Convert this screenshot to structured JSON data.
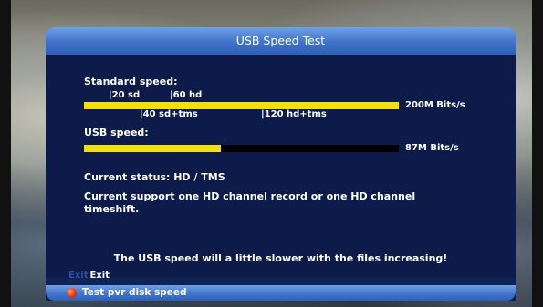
{
  "window": {
    "title": "USB Speed Test"
  },
  "standard": {
    "label": "Standard speed:",
    "ticks_top": [
      "|20 sd",
      "|60 hd"
    ],
    "ticks_bottom": [
      "|40 sd+tms",
      "|120 hd+tms"
    ],
    "value_text": "200M Bits/s",
    "fill_fraction": 1.0
  },
  "usb": {
    "label": "USB speed:",
    "value_text": "87M Bits/s",
    "fill_fraction": 0.435
  },
  "status": {
    "current": "Current status: HD / TMS",
    "support": "Current support one HD channel record or one HD channel timeshift."
  },
  "notice": "The USB speed will a little slower with the files increasing!",
  "footer": {
    "exit_key": "Exit",
    "exit_label": "Exit",
    "red_button_label": "Test pvr disk speed"
  },
  "colors": {
    "bar": "#f3df0a",
    "panel": "#0c1b4a",
    "title": "#3f73c9"
  },
  "icons": {
    "red_button": "red-circle-icon"
  }
}
